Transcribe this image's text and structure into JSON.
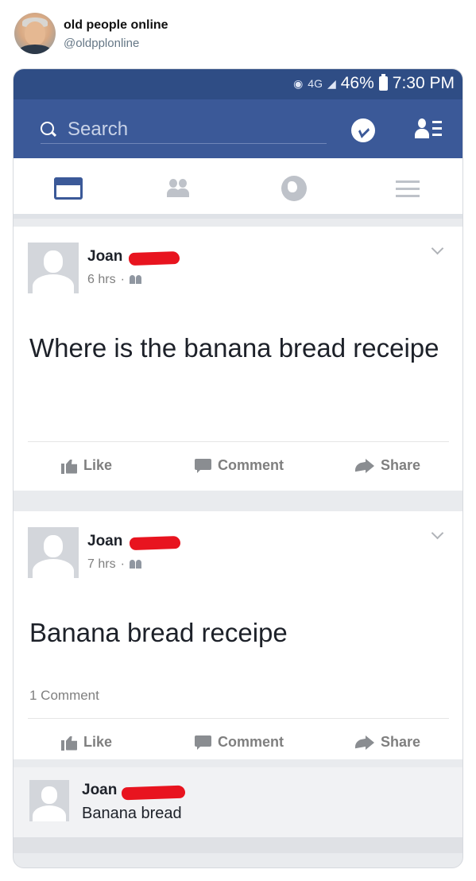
{
  "tweet": {
    "display_name": "old people online",
    "handle": "@oldpplonline"
  },
  "statusbar": {
    "network": "4G",
    "battery": "46%",
    "time": "7:30 PM"
  },
  "topbar": {
    "search_placeholder": "Search"
  },
  "posts": [
    {
      "author": "Joan",
      "time": "6 hrs",
      "text": "Where is the banana bread receipe",
      "actions": {
        "like": "Like",
        "comment": "Comment",
        "share": "Share"
      }
    },
    {
      "author": "Joan",
      "time": "7 hrs",
      "text": "Banana bread receipe",
      "comment_count": "1 Comment",
      "actions": {
        "like": "Like",
        "comment": "Comment",
        "share": "Share"
      }
    }
  ],
  "reply": {
    "author": "Joan",
    "text": "Banana bread"
  },
  "colors": {
    "facebook_blue": "#3b5998",
    "statusbar": "#2f4d85",
    "redaction": "#e8141f"
  },
  "icons": [
    "search-icon",
    "messenger-icon",
    "friend-requests-icon",
    "news-feed-icon",
    "friends-icon",
    "globe-icon",
    "menu-icon",
    "like-icon",
    "comment-icon",
    "share-icon",
    "audience-icon",
    "chevron-down-icon"
  ]
}
